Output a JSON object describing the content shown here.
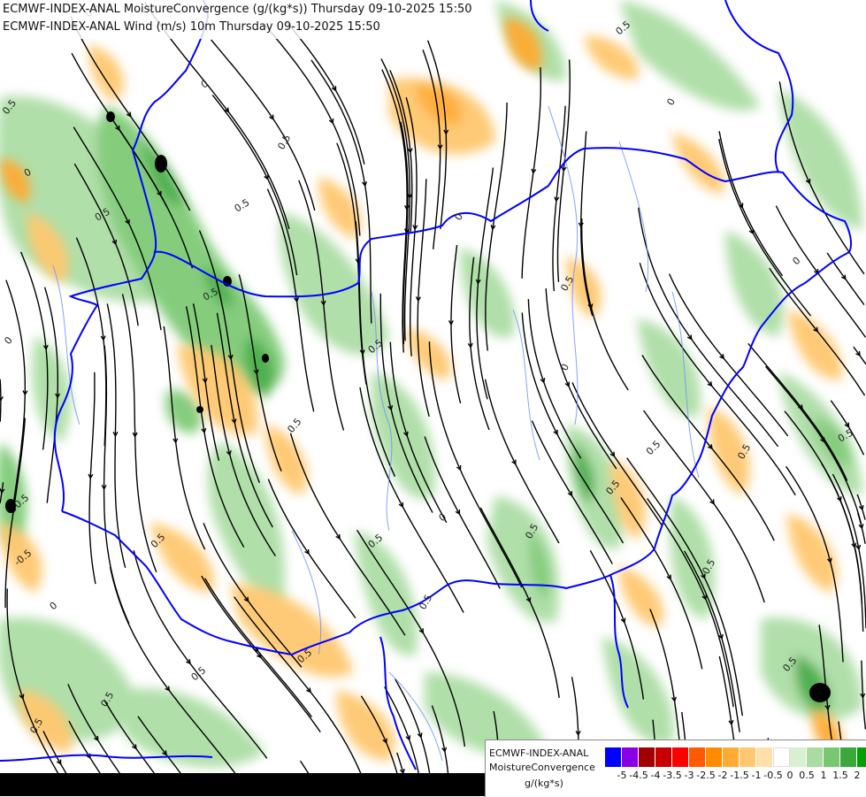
{
  "titles": {
    "line1": "ECMWF-INDEX-ANAL MoistureConvergence (g/(kg*s)) Thursday 09-10-2025 15:50",
    "line2": "ECMWF-INDEX-ANAL Wind (m/s) 10m Thursday 09-10-2025 15:50"
  },
  "legend": {
    "line1": "ECMWF-INDEX-ANAL",
    "line2": "MoistureConvergence",
    "line3": "g/(kg*s)",
    "colors": [
      "#0000ff",
      "#8a00e6",
      "#a00000",
      "#c80000",
      "#ff0000",
      "#ff5a00",
      "#ff8c00",
      "#ffaa30",
      "#ffc870",
      "#ffe0a8",
      "#ffffff",
      "#d8f0d0",
      "#a8dca0",
      "#78c870",
      "#3ca83c",
      "#00a000"
    ],
    "ticks": [
      "-5",
      "-4.5",
      "-4",
      "-3.5",
      "-3",
      "-2.5",
      "-2",
      "-1.5",
      "-1",
      "-0.5",
      "0",
      "0.5",
      "1",
      "1.5",
      "2"
    ]
  },
  "map": {
    "contour_labels": [
      "0.5",
      "0",
      "-0.5"
    ],
    "border_color": "#0000ff",
    "streamline_color": "#000000",
    "river_color": "#6a8cff"
  }
}
